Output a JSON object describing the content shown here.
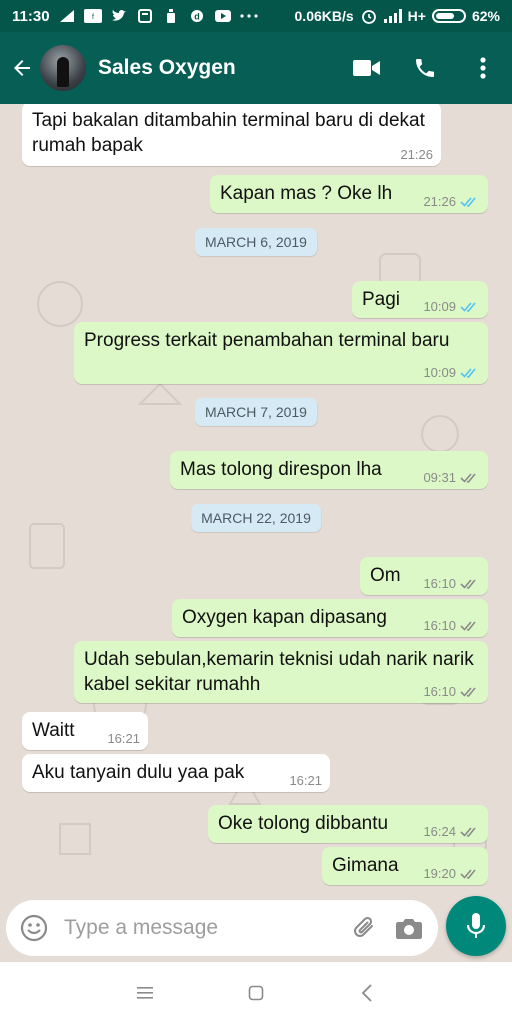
{
  "status_bar": {
    "time": "11:30",
    "net_speed": "0.06KB/s",
    "network": "H+",
    "battery": "62%",
    "icons": [
      "signal-arrow-icon",
      "facebook-lite-icon",
      "twitter-icon",
      "news-icon",
      "cleaner-icon",
      "dailyhunt-icon",
      "youtube-icon",
      "more-dots-icon",
      "alarm-icon",
      "signal-bars-icon",
      "battery-icon"
    ]
  },
  "header": {
    "contact_name": "Sales Oxygen",
    "icons": [
      "back-arrow-icon",
      "avatar",
      "video-call-icon",
      "phone-call-icon",
      "more-vert-icon"
    ]
  },
  "messages": [
    {
      "dir": "in",
      "text": "Tapi bakalan ditambahin terminal baru di dekat rumah bapak",
      "time": "21:26"
    },
    {
      "dir": "out",
      "text": "Kapan mas ? Oke lh",
      "time": "21:26",
      "status": "read"
    },
    {
      "date": "MARCH 6, 2019"
    },
    {
      "dir": "out",
      "text": "Pagi",
      "time": "10:09",
      "status": "read"
    },
    {
      "dir": "out",
      "text": "Progress terkait penambahan terminal baru",
      "time": "10:09",
      "status": "read"
    },
    {
      "date": "MARCH 7, 2019"
    },
    {
      "dir": "out",
      "text": "Mas tolong direspon lha",
      "time": "09:31",
      "status": "delivered"
    },
    {
      "date": "MARCH 22, 2019"
    },
    {
      "dir": "out",
      "text": "Om",
      "time": "16:10",
      "status": "delivered"
    },
    {
      "dir": "out",
      "text": "Oxygen kapan dipasang",
      "time": "16:10",
      "status": "delivered"
    },
    {
      "dir": "out",
      "text": "Udah sebulan,kemarin teknisi udah narik narik kabel sekitar rumahh",
      "time": "16:10",
      "status": "delivered"
    },
    {
      "dir": "in",
      "text": "Waitt",
      "time": "16:21"
    },
    {
      "dir": "in",
      "text": "Aku tanyain dulu yaa pak",
      "time": "16:21"
    },
    {
      "dir": "out",
      "text": "Oke tolong dibbantu",
      "time": "16:24",
      "status": "delivered"
    },
    {
      "dir": "out",
      "text": "Gimana",
      "time": "19:20",
      "status": "delivered"
    }
  ],
  "composer": {
    "placeholder": "Type a message",
    "icons": [
      "emoji-icon",
      "attach-icon",
      "camera-icon",
      "mic-icon"
    ]
  },
  "colors": {
    "header": "#075e54",
    "statusbar": "#04564b",
    "chat_bg": "#e5ddd5",
    "outgoing_bubble": "#dcf8c6",
    "incoming_bubble": "#ffffff",
    "read_tick": "#4fc3f7",
    "delivered_tick": "#8a8a8a",
    "mic_button": "#00897b",
    "date_chip": "#d6eaf5"
  },
  "nav_bar": {
    "icons": [
      "menu-icon",
      "home-square-icon",
      "back-chevron-icon"
    ]
  }
}
